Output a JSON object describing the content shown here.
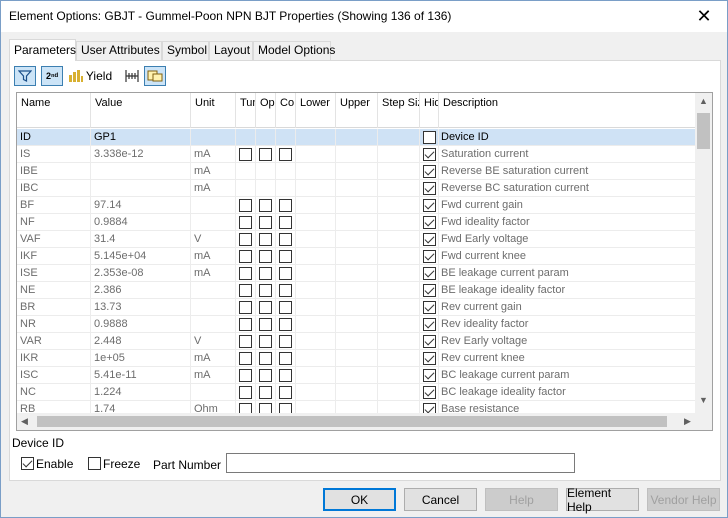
{
  "window": {
    "title": "Element Options: GBJT - Gummel-Poon NPN BJT Properties (Showing 136 of 136)",
    "close_glyph": "✕"
  },
  "tabs": [
    {
      "label": "Parameters",
      "active": true
    },
    {
      "label": "User Attributes",
      "active": false
    },
    {
      "label": "Symbol",
      "active": false
    },
    {
      "label": "Layout",
      "active": false
    },
    {
      "label": "Model Options",
      "active": false
    }
  ],
  "toolbar": {
    "filter_icon": "filter-icon",
    "sort_icon": "sort-icon",
    "sort_glyph": "2ⁿᵈ",
    "yield_label": "Yield",
    "yield_icon": "bar-chart-icon",
    "tune_icon": "tune-icon",
    "view_icon": "window-view-icon"
  },
  "grid": {
    "columns": [
      "Name",
      "Value",
      "Unit",
      "Tun",
      "Op",
      "Co",
      "Lower",
      "Upper",
      "Step Size",
      "Hide",
      "Description"
    ],
    "rows": [
      {
        "name": "ID",
        "value": "GP1",
        "unit": "",
        "checks": false,
        "hide": false,
        "desc": "Device ID",
        "selected": true
      },
      {
        "name": "IS",
        "value": "3.338e-12",
        "unit": "mA",
        "checks": true,
        "hide": true,
        "desc": "Saturation current"
      },
      {
        "name": "IBE",
        "value": "",
        "unit": "mA",
        "checks": false,
        "hide": true,
        "desc": "Reverse BE saturation current"
      },
      {
        "name": "IBC",
        "value": "",
        "unit": "mA",
        "checks": false,
        "hide": true,
        "desc": "Reverse BC saturation current"
      },
      {
        "name": "BF",
        "value": "97.14",
        "unit": "",
        "checks": true,
        "hide": true,
        "desc": "Fwd current gain"
      },
      {
        "name": "NF",
        "value": "0.9884",
        "unit": "",
        "checks": true,
        "hide": true,
        "desc": "Fwd ideality factor"
      },
      {
        "name": "VAF",
        "value": "31.4",
        "unit": "V",
        "checks": true,
        "hide": true,
        "desc": "Fwd Early voltage"
      },
      {
        "name": "IKF",
        "value": "5.145e+04",
        "unit": "mA",
        "checks": true,
        "hide": true,
        "desc": "Fwd current knee"
      },
      {
        "name": "ISE",
        "value": "2.353e-08",
        "unit": "mA",
        "checks": true,
        "hide": true,
        "desc": "BE leakage current param"
      },
      {
        "name": "NE",
        "value": "2.386",
        "unit": "",
        "checks": true,
        "hide": true,
        "desc": "BE leakage ideality factor"
      },
      {
        "name": "BR",
        "value": "13.73",
        "unit": "",
        "checks": true,
        "hide": true,
        "desc": "Rev current gain"
      },
      {
        "name": "NR",
        "value": "0.9888",
        "unit": "",
        "checks": true,
        "hide": true,
        "desc": "Rev ideality factor"
      },
      {
        "name": "VAR",
        "value": "2.448",
        "unit": "V",
        "checks": true,
        "hide": true,
        "desc": "Rev Early voltage"
      },
      {
        "name": "IKR",
        "value": "1e+05",
        "unit": "mA",
        "checks": true,
        "hide": true,
        "desc": "Rev current knee"
      },
      {
        "name": "ISC",
        "value": "5.41e-11",
        "unit": "mA",
        "checks": true,
        "hide": true,
        "desc": "BC leakage current param"
      },
      {
        "name": "NC",
        "value": "1.224",
        "unit": "",
        "checks": true,
        "hide": true,
        "desc": "BC leakage ideality factor"
      },
      {
        "name": "RB",
        "value": "1.74",
        "unit": "Ohm",
        "checks": true,
        "hide": true,
        "desc": "Base resistance"
      }
    ]
  },
  "selected_param": {
    "label": "Device ID"
  },
  "options": {
    "enable_label": "Enable",
    "enable_checked": true,
    "freeze_label": "Freeze",
    "freeze_checked": false,
    "part_number_label": "Part Number",
    "part_number_value": ""
  },
  "buttons": {
    "ok": "OK",
    "cancel": "Cancel",
    "help": "Help",
    "element_help": "Element Help",
    "vendor_help": "Vendor Help"
  },
  "scroll": {
    "up": "▲",
    "down": "▼",
    "left": "◀",
    "right": "▶"
  }
}
